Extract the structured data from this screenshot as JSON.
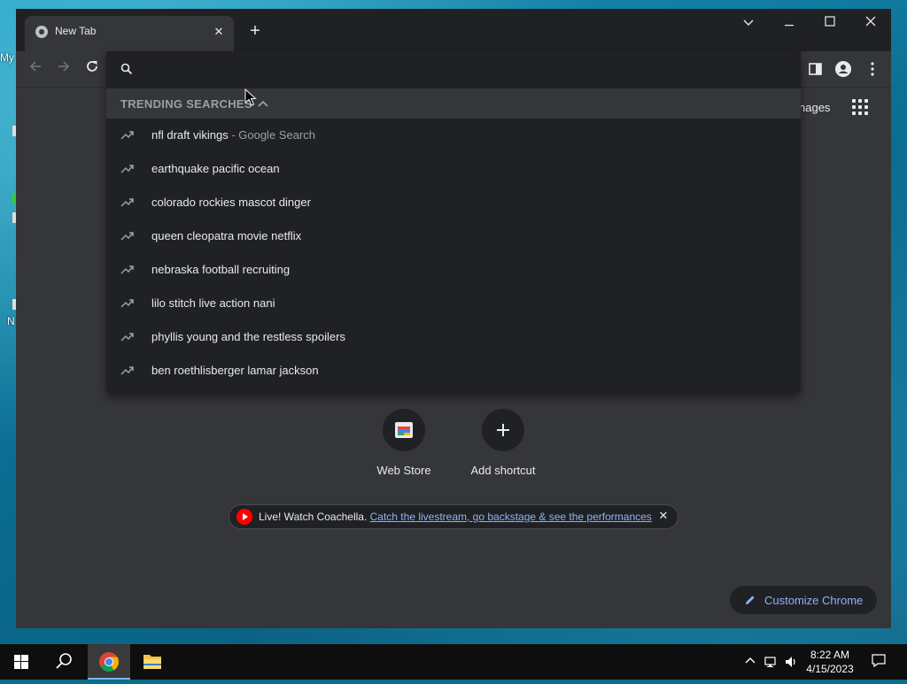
{
  "desktop": {
    "icon_labels": [
      "My",
      "N"
    ]
  },
  "browser": {
    "tab": {
      "title": "New Tab",
      "close": "✕"
    },
    "new_tab": "+",
    "window_controls": {
      "tab_search": "⌵",
      "minimize": "—",
      "maximize": "☐",
      "close": "✕"
    }
  },
  "omnibox": {
    "value": "",
    "placeholder": "",
    "trending_header": "TRENDING SEARCHES",
    "suggestions": [
      {
        "text": "nfl draft vikings",
        "suffix": " - Google Search"
      },
      {
        "text": "earthquake pacific ocean",
        "suffix": ""
      },
      {
        "text": "colorado rockies mascot dinger",
        "suffix": ""
      },
      {
        "text": "queen cleopatra movie netflix",
        "suffix": ""
      },
      {
        "text": "nebraska football recruiting",
        "suffix": ""
      },
      {
        "text": "lilo stitch live action nani",
        "suffix": ""
      },
      {
        "text": "phyllis young and the restless spoilers",
        "suffix": ""
      },
      {
        "text": "ben roethlisberger lamar jackson",
        "suffix": ""
      }
    ]
  },
  "ntp": {
    "images_link": "nages",
    "shortcuts": [
      {
        "label": "Web Store",
        "icon": "web-store-icon"
      },
      {
        "label": "Add shortcut",
        "icon": "plus-icon"
      }
    ],
    "promo": {
      "prefix": "Live! Watch Coachella.",
      "link": "Catch the livestream, go backstage & see the performances"
    },
    "customize": "Customize Chrome"
  },
  "taskbar": {
    "time": "8:22 AM",
    "date": "4/15/2023"
  },
  "colors": {
    "accent_link": "#8ab4f8",
    "surface": "#35363a",
    "dark_surface": "#202124",
    "youtube_red": "#ff0000"
  }
}
